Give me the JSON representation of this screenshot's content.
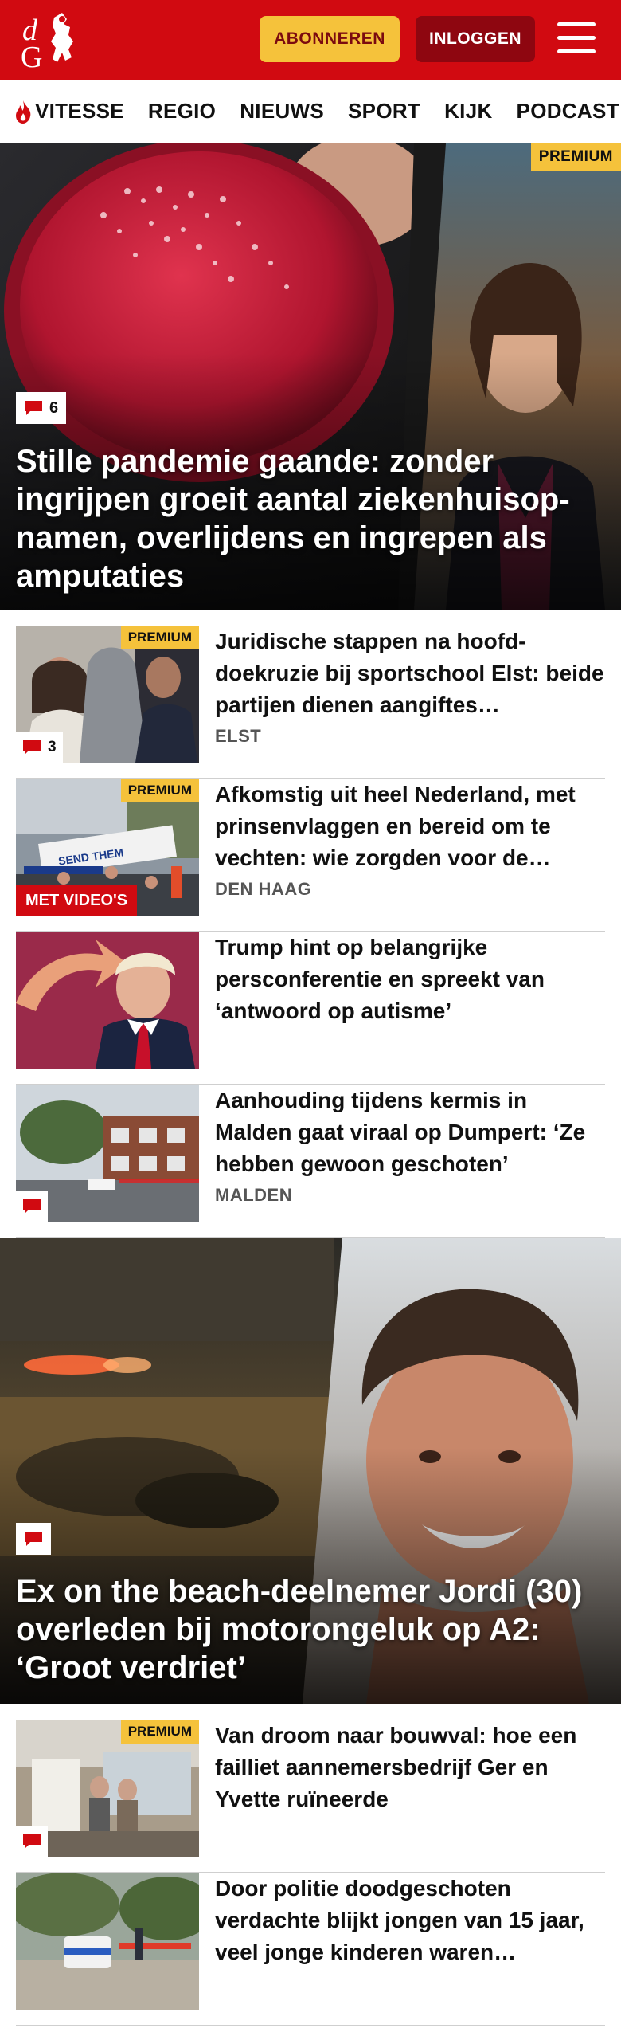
{
  "header": {
    "logo_text": "dG",
    "subscribe_label": "ABONNEREN",
    "login_label": "INLOGGEN"
  },
  "nav": {
    "items": [
      "VITESSE",
      "REGIO",
      "NIEUWS",
      "SPORT",
      "KIJK",
      "PODCAST"
    ]
  },
  "hero1": {
    "premium": "PREMIUM",
    "comments": "6",
    "title": "Stille pandemie gaande: zonder ingrijpen groeit aantal ziekenhuisop­namen, overlijdens en ingrepen als amputaties"
  },
  "articles": [
    {
      "title": "Juridische stappen na hoofd­doekruzie bij sportschool Elst: beide partijen dienen aangiftes…",
      "location": "ELST",
      "premium": "PREMIUM",
      "comments": "3"
    },
    {
      "title": "Afkomstig uit heel Nederland, met prinsenvlaggen en bereid om te vechten: wie zorgden voor de…",
      "location": "DEN HAAG",
      "premium": "PREMIUM",
      "video": "MET VIDEO'S"
    },
    {
      "title": "Trump hint op belangrijke persconferentie en spreekt van ‘antwoord op autisme’"
    },
    {
      "title": "Aanhouding tijdens kermis in Malden gaat viraal op Dumpert: ‘Ze hebben gewoon geschoten’",
      "location": "MALDEN"
    }
  ],
  "hero2": {
    "title": "Ex on the beach-deelnemer Jordi (30) overleden bij motorongeluk op A2: ‘Groot verdriet’"
  },
  "articles2": [
    {
      "title": "Van droom naar bouwval: hoe een failliet aannemersbedrijf Ger en Yvette ruïneerde",
      "premium": "PREMIUM"
    },
    {
      "title": "Door politie doodgeschoten verdachte blijkt jongen van 15 jaar, veel jonge kinderen waren…"
    }
  ],
  "colors": {
    "brand_red": "#d10a11",
    "premium_yellow": "#f5c23b",
    "login_dark_red": "#8e0610"
  }
}
